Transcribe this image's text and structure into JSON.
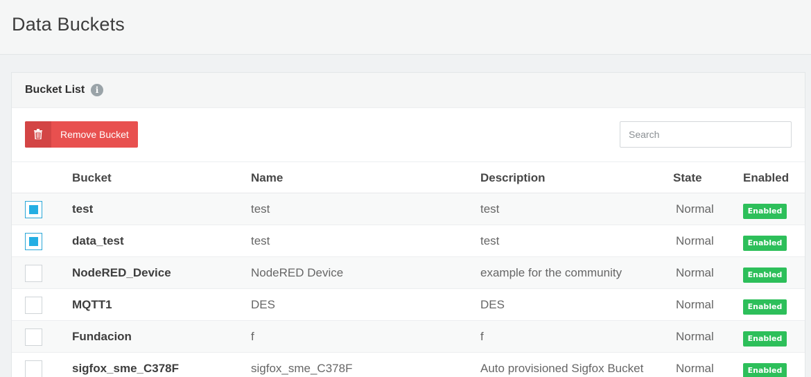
{
  "page": {
    "title": "Data Buckets"
  },
  "panel": {
    "title": "Bucket List",
    "info_icon": "info-icon"
  },
  "toolbar": {
    "remove_label": "Remove Bucket",
    "remove_icon": "trash-icon",
    "remove_color": "#e8504f",
    "search_placeholder": "Search",
    "search_value": ""
  },
  "table": {
    "headers": {
      "bucket": "Bucket",
      "name": "Name",
      "description": "Description",
      "state": "State",
      "enabled": "Enabled"
    },
    "rows": [
      {
        "checked": true,
        "bucket": "test",
        "name": "test",
        "description": "test",
        "state": "Normal",
        "enabled": "Enabled"
      },
      {
        "checked": true,
        "bucket": "data_test",
        "name": "test",
        "description": "test",
        "state": "Normal",
        "enabled": "Enabled"
      },
      {
        "checked": false,
        "bucket": "NodeRED_Device",
        "name": "NodeRED Device",
        "description": "example for the community",
        "state": "Normal",
        "enabled": "Enabled"
      },
      {
        "checked": false,
        "bucket": "MQTT1",
        "name": "DES",
        "description": "DES",
        "state": "Normal",
        "enabled": "Enabled"
      },
      {
        "checked": false,
        "bucket": "Fundacion",
        "name": "f",
        "description": "f",
        "state": "Normal",
        "enabled": "Enabled"
      },
      {
        "checked": false,
        "bucket": "sigfox_sme_C378F",
        "name": "sigfox_sme_C378F",
        "description": "Auto provisioned Sigfox Bucket",
        "state": "Normal",
        "enabled": "Enabled"
      }
    ]
  },
  "colors": {
    "enabled_badge": "#2dbf5a",
    "checkbox_checked": "#23aee3",
    "danger": "#e8504f"
  }
}
